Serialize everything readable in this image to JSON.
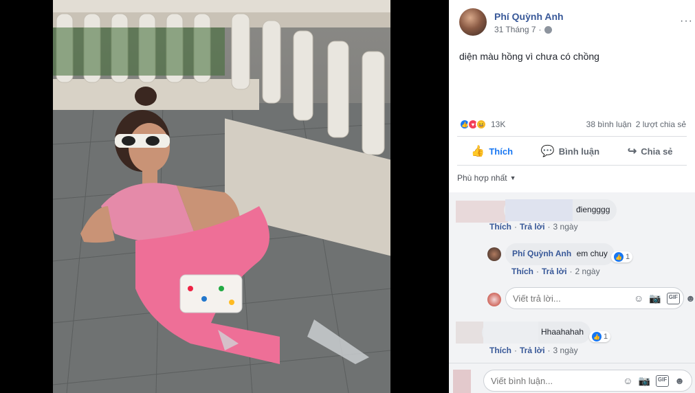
{
  "post": {
    "author": "Phí Quỳnh Anh",
    "date": "31 Tháng 7",
    "text": "diện màu hồng vì chưa có chồng",
    "more": "···"
  },
  "reactions": {
    "count": "13K",
    "comments": "38 bình luận",
    "shares": "2 lượt chia sẻ"
  },
  "actions": {
    "like": "Thích",
    "comment": "Bình luận",
    "share": "Chia sẻ"
  },
  "sort": {
    "label": "Phù hợp nhất"
  },
  "comments": [
    {
      "author": "",
      "text": "điengggg",
      "like": "Thích",
      "reply": "Trả lời",
      "time": "3 ngày"
    },
    {
      "author": "Phí Quỳnh Anh",
      "text": "em chuy",
      "like": "Thích",
      "reply": "Trả lời",
      "time": "2 ngày",
      "reactions": "1"
    },
    {
      "author": "",
      "text": "Hhaahahah",
      "like": "Thích",
      "reply": "Trả lời",
      "time": "3 ngày",
      "reactions": "1"
    }
  ],
  "reply_input": {
    "placeholder": "Viết trả lời..."
  },
  "main_input": {
    "placeholder": "Viết bình luận..."
  },
  "icons": [
    "globe-icon",
    "more-icon",
    "like-icon",
    "comment-icon",
    "share-icon",
    "emoji-icon",
    "camera-icon",
    "gif-icon",
    "sticker-icon"
  ],
  "colors": {
    "link": "#385898",
    "like": "#1877f2",
    "comment_bg": "#f2f3f5"
  }
}
